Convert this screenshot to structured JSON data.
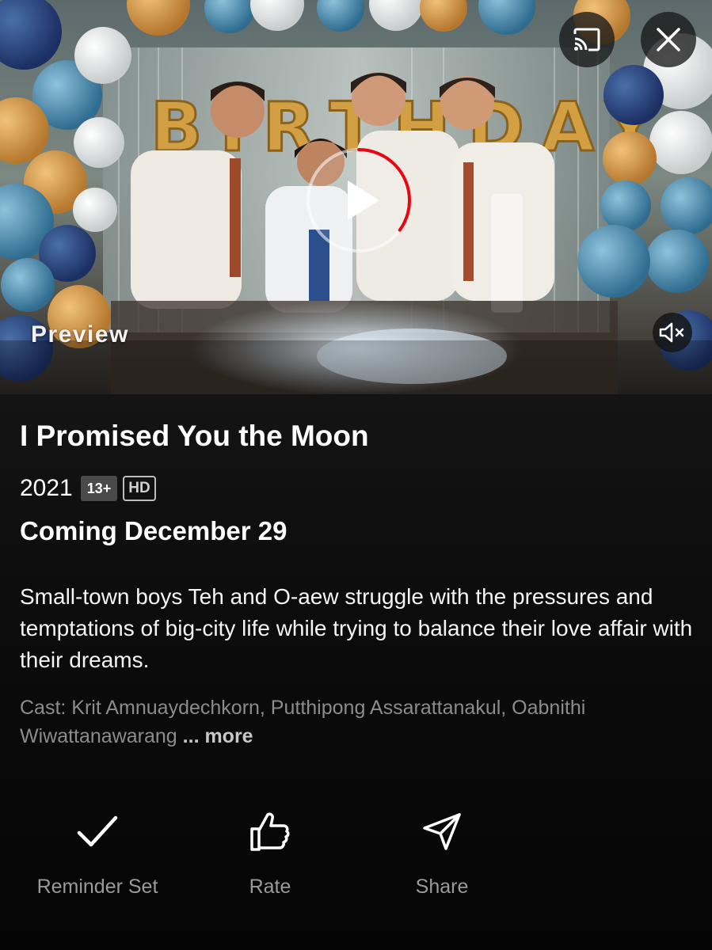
{
  "preview": {
    "label": "Preview",
    "banner_text": "BIRTHDAY",
    "cast_icon": "cast-icon",
    "close_icon": "close-icon",
    "mute_icon": "muted-speaker-icon",
    "play_icon": "play-icon",
    "progress": 0.35
  },
  "title": {
    "name": "I Promised You the Moon",
    "year": "2021",
    "rating": "13+",
    "quality": "HD",
    "release": "Coming December 29"
  },
  "synopsis": "Small-town boys Teh and O-aew struggle with the pressures and temptations of big-city life while trying to balance their love affair with their dreams.",
  "cast": {
    "text": "Cast: Krit Amnuaydechkorn, Putthipong Assarattanakul, Oabnithi Wiwattanawarang",
    "more": "... more"
  },
  "actions": [
    {
      "label": "Reminder Set",
      "icon": "checkmark-icon"
    },
    {
      "label": "Rate",
      "icon": "thumbs-up-icon"
    },
    {
      "label": "Share",
      "icon": "send-icon"
    }
  ],
  "colors": {
    "background": "#000000",
    "progress_red": "#e50914",
    "muted_text": "#8c8c8c",
    "badge_bg": "#4a4a4a"
  }
}
